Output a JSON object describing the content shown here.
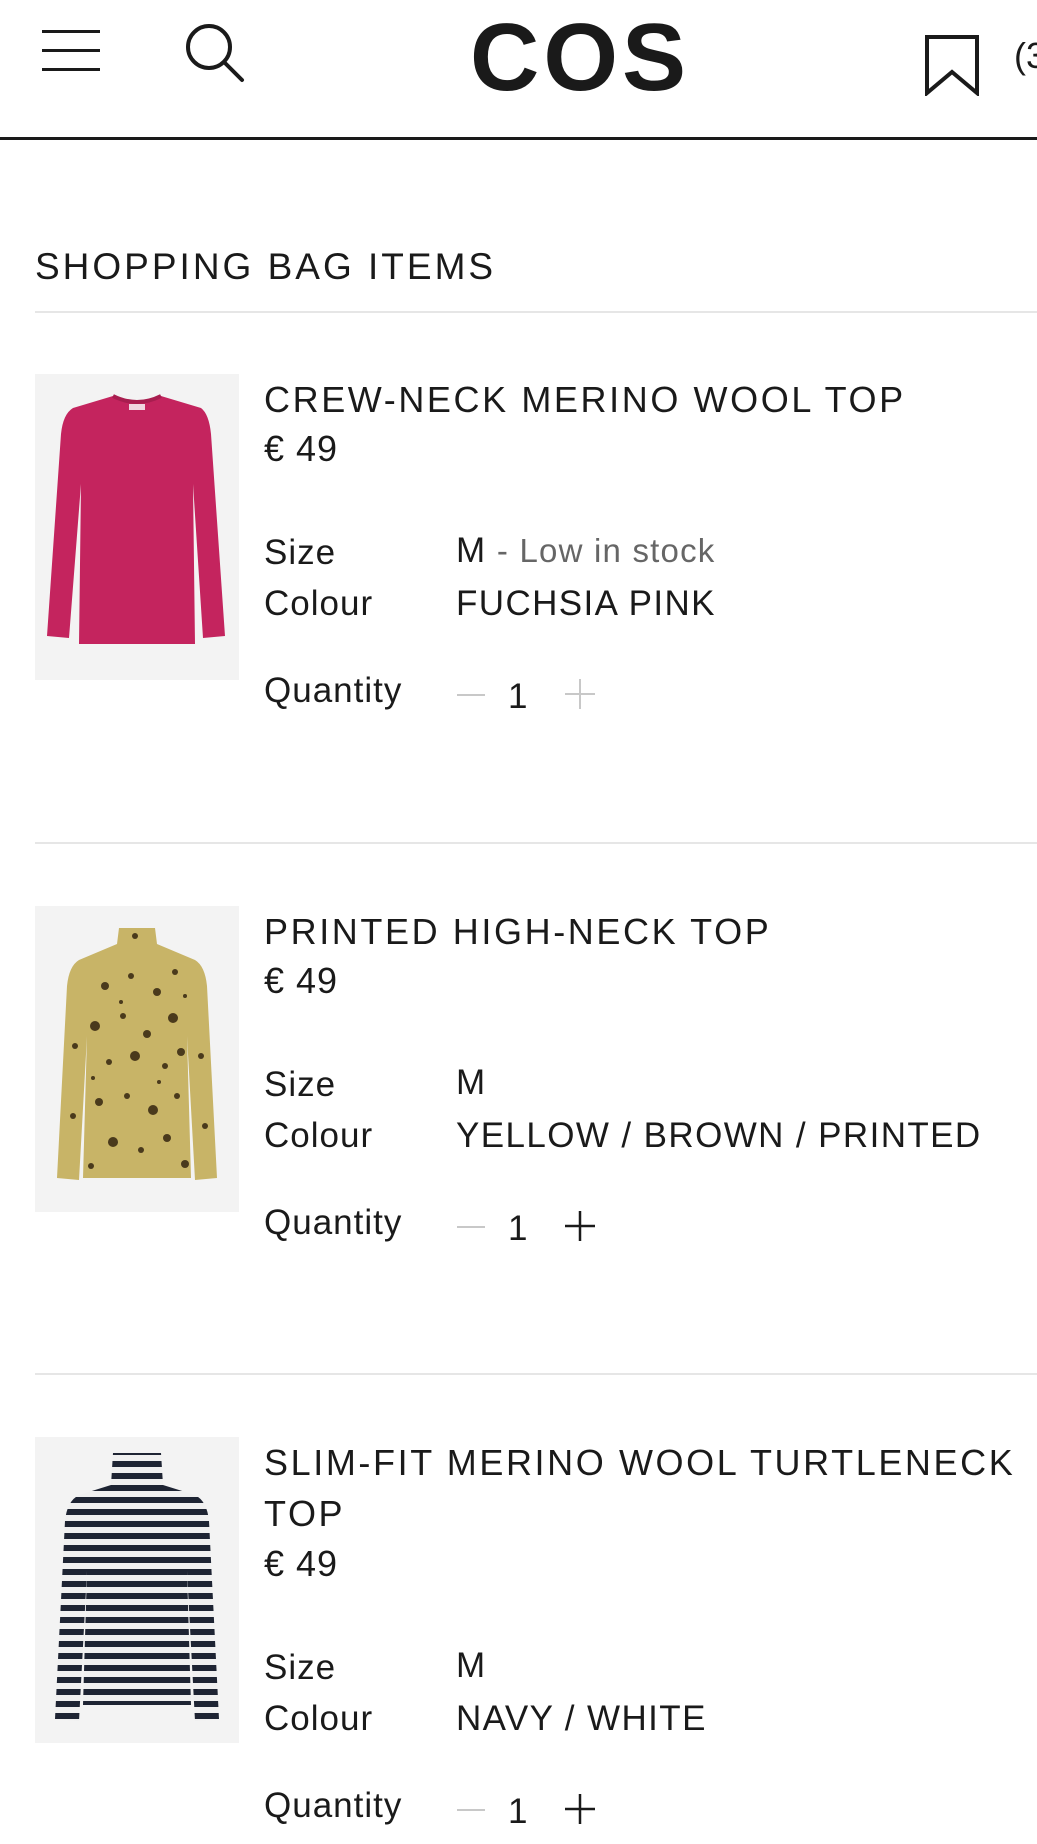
{
  "header": {
    "menu_icon": "hamburger-menu-icon",
    "search_icon": "search-icon",
    "logo": "COS",
    "bookmark_icon": "bookmark-icon",
    "bag_count": "(3"
  },
  "section": {
    "title": "SHOPPING BAG ITEMS"
  },
  "labels": {
    "size": "Size",
    "colour": "Colour",
    "quantity": "Quantity"
  },
  "items": [
    {
      "name": "CREW-NECK MERINO WOOL TOP",
      "price": "€ 49",
      "size": "M",
      "stock_note": " - Low in stock",
      "colour": "FUCHSIA PINK",
      "quantity": "1",
      "image": "fuchsia-pink-long-sleeve-top",
      "color": "#c4245e"
    },
    {
      "name": "PRINTED HIGH-NECK TOP",
      "price": "€ 49",
      "size": "M",
      "colour": "YELLOW / BROWN / PRINTED",
      "quantity": "1",
      "image": "leopard-print-high-neck-top",
      "color": "#c8b467"
    },
    {
      "name": "SLIM-FIT MERINO WOOL TURTLENECK TOP",
      "price": "€ 49",
      "size": "M",
      "colour": "NAVY / WHITE",
      "quantity": "1",
      "image": "navy-white-striped-turtleneck",
      "color": "#1e2433"
    }
  ]
}
